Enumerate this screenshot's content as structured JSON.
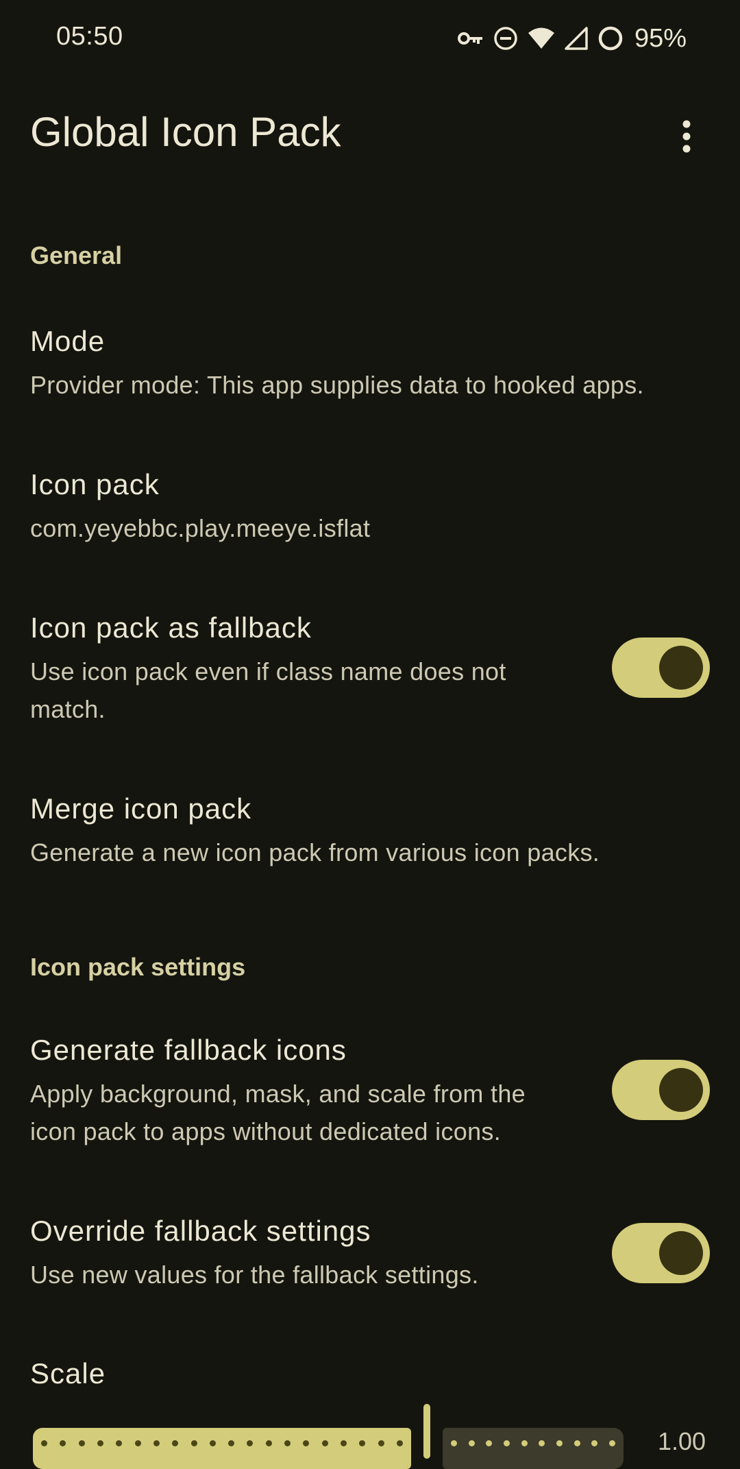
{
  "status_bar": {
    "time": "05:50",
    "battery": "95%",
    "icons": [
      "vpn-key-icon",
      "do-not-disturb-icon",
      "wifi-icon",
      "cell-signal-icon",
      "battery-saver-icon"
    ]
  },
  "app_bar": {
    "title": "Global Icon Pack",
    "overflow_icon": "more-vert-icon"
  },
  "sections": {
    "general": {
      "header": "General",
      "mode": {
        "title": "Mode",
        "summary": "Provider mode: This app supplies data to hooked apps."
      },
      "icon_pack": {
        "title": "Icon pack",
        "summary": "com.yeyebbc.play.meeye.isflat"
      },
      "icon_pack_fallback": {
        "title": "Icon pack as fallback",
        "summary": "Use icon pack even if class name does not match.",
        "enabled": true
      },
      "merge_icon_pack": {
        "title": "Merge icon pack",
        "summary": "Generate a new icon pack from various icon packs."
      }
    },
    "icon_pack_settings": {
      "header": "Icon pack settings",
      "generate_fallback": {
        "title": "Generate fallback icons",
        "summary": "Apply background, mask, and scale from the icon pack to apps without dedicated icons.",
        "enabled": true
      },
      "override_fallback": {
        "title": "Override fallback settings",
        "summary": "Use new values for the fallback settings.",
        "enabled": true
      },
      "scale": {
        "title": "Scale",
        "value": "1.00"
      }
    }
  },
  "colors": {
    "background": "#15150f",
    "accent": "#d3cc7a",
    "thumb": "#363212",
    "category_text": "#d6d0a4"
  }
}
